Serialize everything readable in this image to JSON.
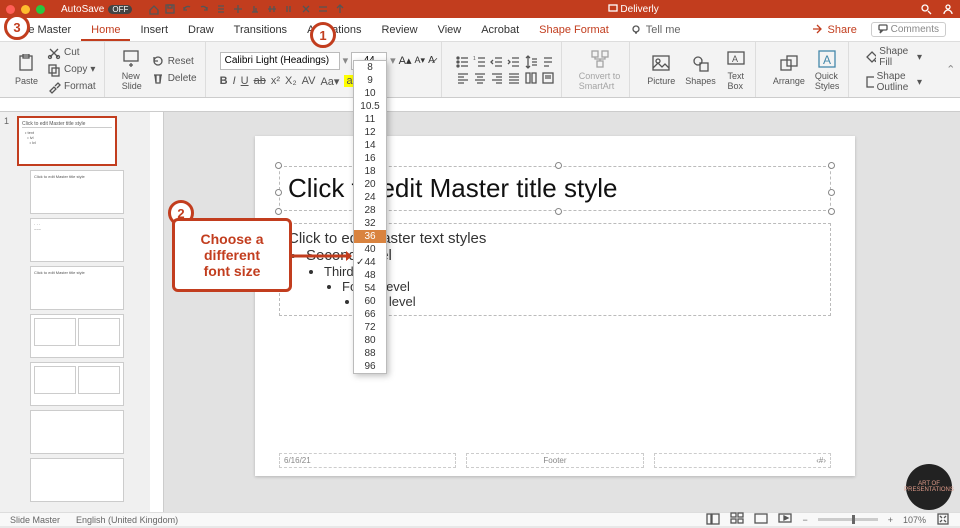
{
  "window": {
    "title": "Deliverly",
    "autosave_label": "AutoSave",
    "autosave_state": "OFF"
  },
  "tabs": {
    "items": [
      "Slide Master",
      "Home",
      "Insert",
      "Draw",
      "Transitions",
      "Animations",
      "Review",
      "View",
      "Acrobat",
      "Shape Format"
    ],
    "active": "Home",
    "tellme": "Tell me",
    "share": "Share",
    "comments": "Comments"
  },
  "ribbon": {
    "clipboard": {
      "paste": "Paste",
      "cut": "Cut",
      "copy": "Copy",
      "format": "Format"
    },
    "slides": {
      "new_slide": "New\nSlide",
      "delete": "Delete",
      "reset": "Reset"
    },
    "font": {
      "name": "Calibri Light (Headings)",
      "size": "44"
    },
    "convert": "Convert to\nSmartArt",
    "insert": {
      "picture": "Picture",
      "shapes": "Shapes",
      "textbox": "Text\nBox"
    },
    "arrange": {
      "arrange": "Arrange",
      "quick": "Quick\nStyles"
    },
    "shape": {
      "fill": "Shape Fill",
      "outline": "Shape Outline"
    }
  },
  "font_sizes": [
    "8",
    "9",
    "10",
    "10.5",
    "11",
    "12",
    "14",
    "16",
    "18",
    "20",
    "24",
    "28",
    "32",
    "36",
    "40",
    "44",
    "48",
    "54",
    "60",
    "66",
    "72",
    "80",
    "88",
    "96"
  ],
  "font_size_selected": "36",
  "font_size_current": "44",
  "slide": {
    "title": "Click to edit Master title style",
    "body_heading": "Click to edit Master text styles",
    "levels": [
      "Second level",
      "Third level",
      "Fourth level",
      "Fifth level"
    ],
    "date": "6/16/21",
    "footer": "Footer",
    "pagenum": "‹#›"
  },
  "thumbs": {
    "master_label": "Click to edit Master title style"
  },
  "callouts": {
    "c1": "1",
    "c2": "2",
    "c3": "3",
    "c2_text": "Choose a different font size"
  },
  "status": {
    "view": "Slide Master",
    "lang": "English (United Kingdom)",
    "zoom": "107%"
  },
  "logo_text": "ART OF\nPRESENTATIONS"
}
